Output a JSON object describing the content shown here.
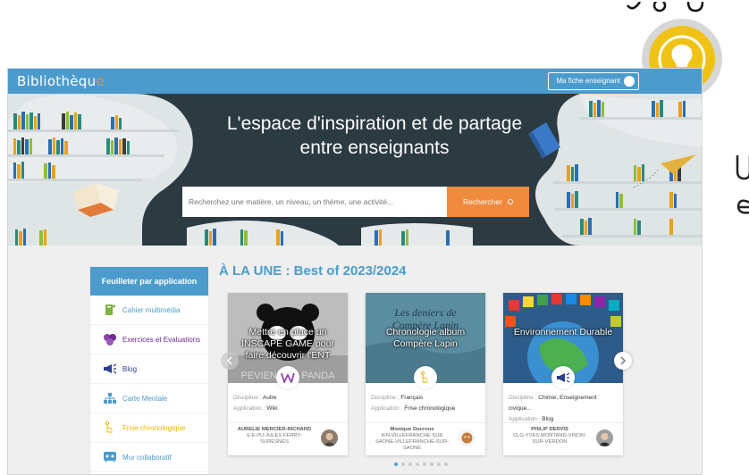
{
  "app": {
    "logo_main": "Bibliothèqu",
    "logo_accent": "e",
    "teacher_button": "Ma fiche enseignant"
  },
  "hero": {
    "title": "L'espace d'inspiration et de partage entre enseignants",
    "search_placeholder": "Recherchez une matière, un niveau, un thème, une activité...",
    "search_button": "Rechercher"
  },
  "sidebar": {
    "header": "Feuilleter par application",
    "items": [
      {
        "label": "Cahier multimédia",
        "icon": "notebook-icon",
        "color": "#4b9ccd"
      },
      {
        "label": "Exercices et Evaluations",
        "icon": "exercises-icon",
        "color": "#8e44ad"
      },
      {
        "label": "Blog",
        "icon": "megaphone-icon",
        "color": "#2c3e8f"
      },
      {
        "label": "Carte Mentale",
        "icon": "mindmap-icon",
        "color": "#4b9ccd"
      },
      {
        "label": "Frise chronologique",
        "icon": "timeline-icon",
        "color": "#f0b400"
      },
      {
        "label": "Mur collaboratif",
        "icon": "wall-icon",
        "color": "#4b9ccd"
      }
    ]
  },
  "featured": {
    "title": "À LA UNE : Best of 2023/2024",
    "discipline_label": "Discipline :",
    "application_label": "Application :",
    "cards": [
      {
        "image_title": "Mettre en place un INSCAPE GAME pour faire découvrir l'ENT",
        "discipline": "Autre",
        "application": "Wiki",
        "author": "AURELIE MERCIER-RICHARD",
        "school": "E.E.PU-JULES FERRY-SURESNES"
      },
      {
        "image_title": "Chronologie album Compère Lapin",
        "discipline": "Français",
        "application": "Frise chronologique",
        "author": "Monique Ducroux",
        "school": "IEN-VILLEFRANCHE SUR SAONE-VILLEFRANCHE-SUR-SAONE"
      },
      {
        "image_title": "Environnement Durable",
        "discipline": "Chimie, Enseignement civique...",
        "application": "Blog",
        "author": "PHILIP DERVIS",
        "school": "CLG-YVES MONTAND-VINON-SUR-VERDON"
      }
    ],
    "page_dots": 8,
    "active_dot": 0
  },
  "colors": {
    "primary": "#4b9ccd",
    "accent": "#f08a3c",
    "hero_bg": "#2c3a42",
    "bulb": "#f0c215"
  }
}
